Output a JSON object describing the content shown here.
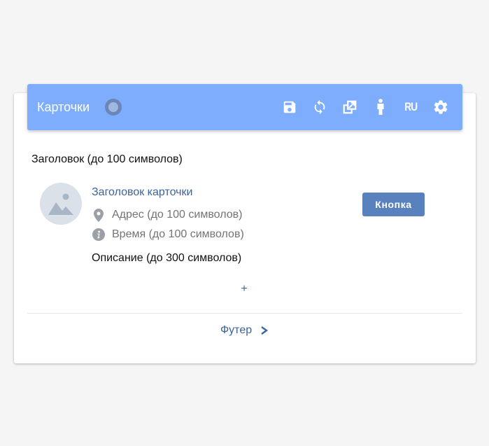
{
  "toolbar": {
    "title": "Карточки",
    "icons": [
      "save-icon",
      "refresh-icon",
      "open-in-new-icon",
      "person-icon",
      "language-icon",
      "gear-icon"
    ],
    "language": "RU",
    "background_color": "#7eadfd"
  },
  "section": {
    "header": "Заголовок (до 100 символов)"
  },
  "card": {
    "avatar_icon": "image-placeholder-icon",
    "title": "Заголовок карточки",
    "address": "Адрес (до 100 символов)",
    "address_icon": "map-pin-icon",
    "time": "Время (до 100 символов)",
    "time_icon": "info-icon",
    "description": "Описание (до 300 символов)",
    "button_label": "Кнопка",
    "button_color": "#5981be"
  },
  "add_label": "+",
  "footer": {
    "label": "Футер",
    "chevron": ">"
  }
}
